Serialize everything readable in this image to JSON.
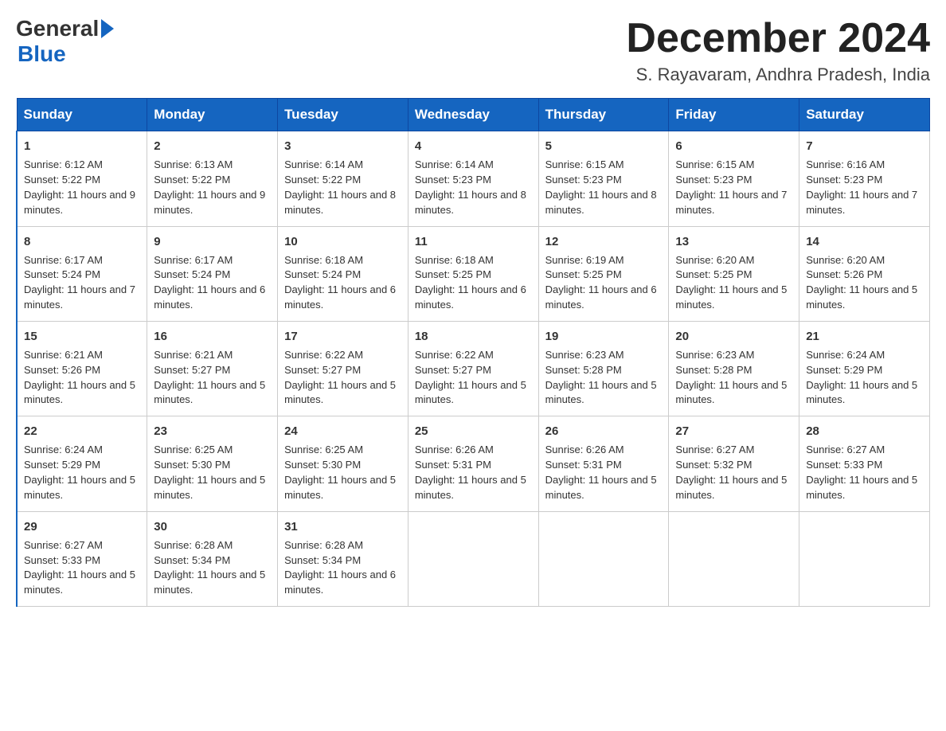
{
  "header": {
    "logo_general": "General",
    "logo_blue": "Blue",
    "month_title": "December 2024",
    "location": "S. Rayavaram, Andhra Pradesh, India"
  },
  "days_of_week": [
    "Sunday",
    "Monday",
    "Tuesday",
    "Wednesday",
    "Thursday",
    "Friday",
    "Saturday"
  ],
  "weeks": [
    [
      {
        "day": "1",
        "sunrise": "6:12 AM",
        "sunset": "5:22 PM",
        "daylight": "11 hours and 9 minutes."
      },
      {
        "day": "2",
        "sunrise": "6:13 AM",
        "sunset": "5:22 PM",
        "daylight": "11 hours and 9 minutes."
      },
      {
        "day": "3",
        "sunrise": "6:14 AM",
        "sunset": "5:22 PM",
        "daylight": "11 hours and 8 minutes."
      },
      {
        "day": "4",
        "sunrise": "6:14 AM",
        "sunset": "5:23 PM",
        "daylight": "11 hours and 8 minutes."
      },
      {
        "day": "5",
        "sunrise": "6:15 AM",
        "sunset": "5:23 PM",
        "daylight": "11 hours and 8 minutes."
      },
      {
        "day": "6",
        "sunrise": "6:15 AM",
        "sunset": "5:23 PM",
        "daylight": "11 hours and 7 minutes."
      },
      {
        "day": "7",
        "sunrise": "6:16 AM",
        "sunset": "5:23 PM",
        "daylight": "11 hours and 7 minutes."
      }
    ],
    [
      {
        "day": "8",
        "sunrise": "6:17 AM",
        "sunset": "5:24 PM",
        "daylight": "11 hours and 7 minutes."
      },
      {
        "day": "9",
        "sunrise": "6:17 AM",
        "sunset": "5:24 PM",
        "daylight": "11 hours and 6 minutes."
      },
      {
        "day": "10",
        "sunrise": "6:18 AM",
        "sunset": "5:24 PM",
        "daylight": "11 hours and 6 minutes."
      },
      {
        "day": "11",
        "sunrise": "6:18 AM",
        "sunset": "5:25 PM",
        "daylight": "11 hours and 6 minutes."
      },
      {
        "day": "12",
        "sunrise": "6:19 AM",
        "sunset": "5:25 PM",
        "daylight": "11 hours and 6 minutes."
      },
      {
        "day": "13",
        "sunrise": "6:20 AM",
        "sunset": "5:25 PM",
        "daylight": "11 hours and 5 minutes."
      },
      {
        "day": "14",
        "sunrise": "6:20 AM",
        "sunset": "5:26 PM",
        "daylight": "11 hours and 5 minutes."
      }
    ],
    [
      {
        "day": "15",
        "sunrise": "6:21 AM",
        "sunset": "5:26 PM",
        "daylight": "11 hours and 5 minutes."
      },
      {
        "day": "16",
        "sunrise": "6:21 AM",
        "sunset": "5:27 PM",
        "daylight": "11 hours and 5 minutes."
      },
      {
        "day": "17",
        "sunrise": "6:22 AM",
        "sunset": "5:27 PM",
        "daylight": "11 hours and 5 minutes."
      },
      {
        "day": "18",
        "sunrise": "6:22 AM",
        "sunset": "5:27 PM",
        "daylight": "11 hours and 5 minutes."
      },
      {
        "day": "19",
        "sunrise": "6:23 AM",
        "sunset": "5:28 PM",
        "daylight": "11 hours and 5 minutes."
      },
      {
        "day": "20",
        "sunrise": "6:23 AM",
        "sunset": "5:28 PM",
        "daylight": "11 hours and 5 minutes."
      },
      {
        "day": "21",
        "sunrise": "6:24 AM",
        "sunset": "5:29 PM",
        "daylight": "11 hours and 5 minutes."
      }
    ],
    [
      {
        "day": "22",
        "sunrise": "6:24 AM",
        "sunset": "5:29 PM",
        "daylight": "11 hours and 5 minutes."
      },
      {
        "day": "23",
        "sunrise": "6:25 AM",
        "sunset": "5:30 PM",
        "daylight": "11 hours and 5 minutes."
      },
      {
        "day": "24",
        "sunrise": "6:25 AM",
        "sunset": "5:30 PM",
        "daylight": "11 hours and 5 minutes."
      },
      {
        "day": "25",
        "sunrise": "6:26 AM",
        "sunset": "5:31 PM",
        "daylight": "11 hours and 5 minutes."
      },
      {
        "day": "26",
        "sunrise": "6:26 AM",
        "sunset": "5:31 PM",
        "daylight": "11 hours and 5 minutes."
      },
      {
        "day": "27",
        "sunrise": "6:27 AM",
        "sunset": "5:32 PM",
        "daylight": "11 hours and 5 minutes."
      },
      {
        "day": "28",
        "sunrise": "6:27 AM",
        "sunset": "5:33 PM",
        "daylight": "11 hours and 5 minutes."
      }
    ],
    [
      {
        "day": "29",
        "sunrise": "6:27 AM",
        "sunset": "5:33 PM",
        "daylight": "11 hours and 5 minutes."
      },
      {
        "day": "30",
        "sunrise": "6:28 AM",
        "sunset": "5:34 PM",
        "daylight": "11 hours and 5 minutes."
      },
      {
        "day": "31",
        "sunrise": "6:28 AM",
        "sunset": "5:34 PM",
        "daylight": "11 hours and 6 minutes."
      },
      null,
      null,
      null,
      null
    ]
  ],
  "labels": {
    "sunrise": "Sunrise:",
    "sunset": "Sunset:",
    "daylight": "Daylight:"
  }
}
